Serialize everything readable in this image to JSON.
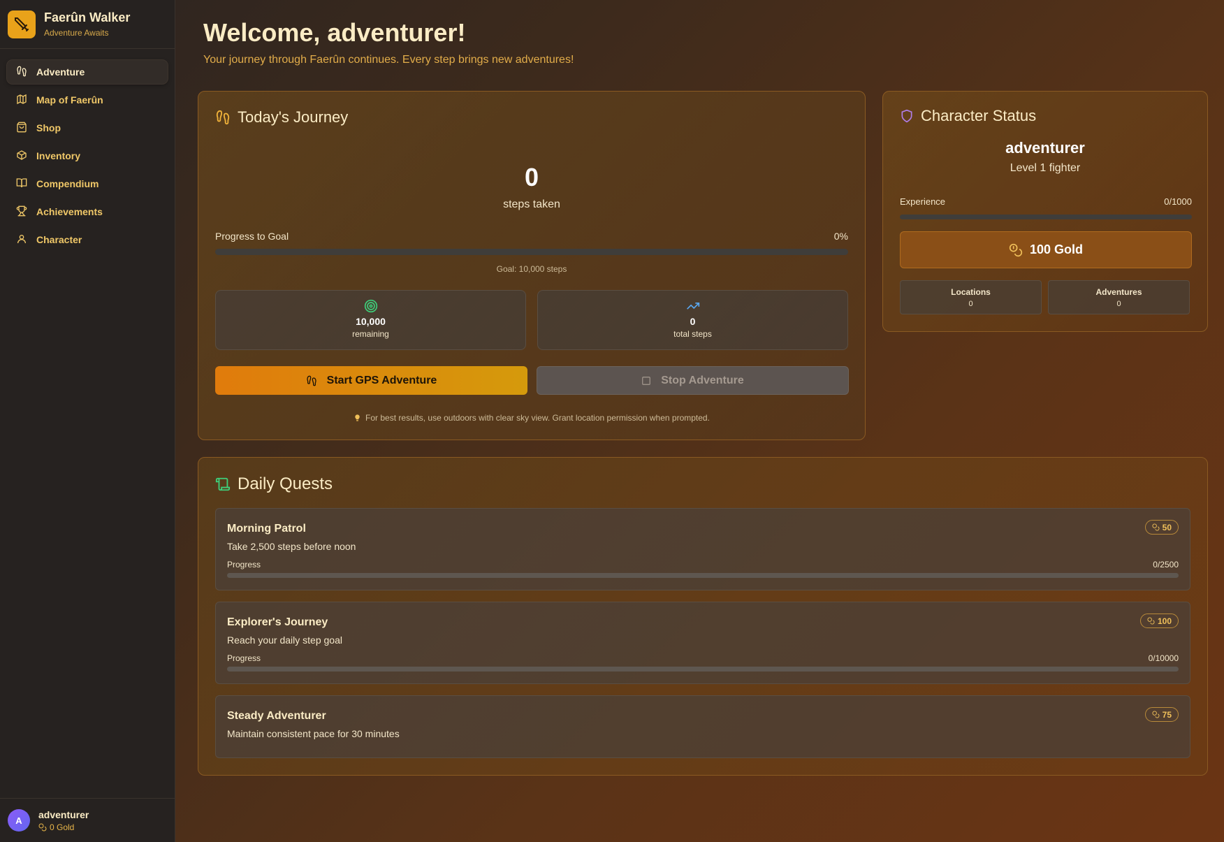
{
  "brand": {
    "title": "Faerûn Walker",
    "subtitle": "Adventure Awaits",
    "icon": "sword-icon"
  },
  "nav": [
    {
      "label": "Adventure",
      "icon": "footprints-icon",
      "active": true
    },
    {
      "label": "Map of Faerûn",
      "icon": "map-icon"
    },
    {
      "label": "Shop",
      "icon": "shop-bag-icon"
    },
    {
      "label": "Inventory",
      "icon": "package-icon"
    },
    {
      "label": "Compendium",
      "icon": "book-icon"
    },
    {
      "label": "Achievements",
      "icon": "trophy-icon"
    },
    {
      "label": "Character",
      "icon": "user-icon"
    }
  ],
  "user": {
    "initial": "A",
    "name": "adventurer",
    "gold": "0 Gold"
  },
  "header": {
    "title": "Welcome, adventurer!",
    "subtitle": "Your journey through Faerûn continues. Every step brings new adventures!"
  },
  "journey": {
    "title": "Today's Journey",
    "steps": "0",
    "steps_label": "steps taken",
    "progress_label": "Progress to Goal",
    "progress_text": "0%",
    "progress_fraction": 0,
    "goal_text": "Goal: 10,000 steps",
    "remaining_value": "10,000",
    "remaining_label": "remaining",
    "total_value": "0",
    "total_label": "total steps",
    "start_label": "Start GPS Adventure",
    "stop_label": "Stop Adventure",
    "hint": "For best results, use outdoors with clear sky view. Grant location permission when prompted."
  },
  "character": {
    "title": "Character Status",
    "name": "adventurer",
    "level": "Level 1 fighter",
    "exp_label": "Experience",
    "exp_value": "0/1000",
    "exp_fraction": 0,
    "gold": "100 Gold",
    "locations_label": "Locations",
    "locations_value": "0",
    "adventures_label": "Adventures",
    "adventures_value": "0"
  },
  "quests": {
    "title": "Daily Quests",
    "progress_label": "Progress",
    "items": [
      {
        "title": "Morning Patrol",
        "desc": "Take 2,500 steps before noon",
        "reward": "50",
        "progress": "0/2500"
      },
      {
        "title": "Explorer's Journey",
        "desc": "Reach your daily step goal",
        "reward": "100",
        "progress": "0/10000"
      },
      {
        "title": "Steady Adventurer",
        "desc": "Maintain consistent pace for 30 minutes",
        "reward": "75"
      }
    ]
  },
  "colors": {
    "accent": "#e9a21a",
    "brand_bg": "#e9a21a",
    "sidebar_bg": "#262220",
    "start_button": "#e07b0c"
  }
}
